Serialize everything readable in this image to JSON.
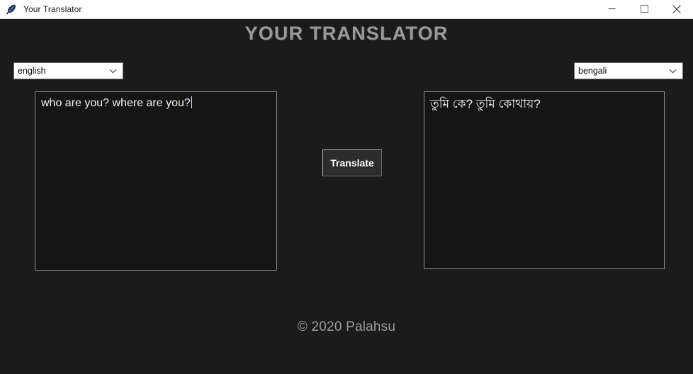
{
  "window": {
    "title": "Your Translator",
    "icon": "feather-icon",
    "controls": {
      "minimize": "minimize-icon",
      "maximize": "maximize-icon",
      "close": "close-icon"
    },
    "titlebar_bg": "#ffffff",
    "app_bg": "#1b1b1b"
  },
  "app": {
    "heading": "YOUR TRANSLATOR",
    "heading_color": "#9a9a9a",
    "source": {
      "language_selected": "english",
      "language_options": [
        "english",
        "bengali"
      ],
      "text": "who are you? where are you?",
      "caret_visible": true
    },
    "target": {
      "language_selected": "bengali",
      "language_options": [
        "english",
        "bengali"
      ],
      "text": "তুমি কে? তুমি কোথায়?"
    },
    "translate_button": {
      "label": "Translate",
      "bg": "#2c2c2c",
      "text_color": "#ffffff"
    },
    "footer": "© 2020 Palahsu",
    "footer_color": "#9b9b9b"
  }
}
